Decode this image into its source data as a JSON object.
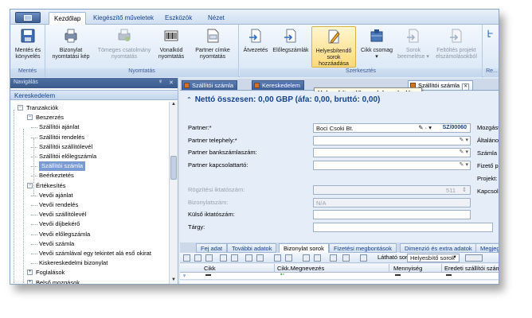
{
  "ribbon_tabs": [
    "Kezdőlap",
    "Kiegészítő műveletek",
    "Eszközök",
    "Nézet"
  ],
  "ribbon": {
    "groups": [
      {
        "label": "Mentés",
        "buttons": [
          {
            "label": [
              "Mentés és",
              "könyvelés"
            ],
            "icon": "save-icon",
            "disabled": false
          }
        ]
      },
      {
        "label": "Nyomtatás",
        "buttons": [
          {
            "label": [
              "Bizonylat",
              "nyomtatási kép"
            ],
            "icon": "print-preview-icon",
            "disabled": false
          },
          {
            "label": [
              "Tömeges csatolmány",
              "nyomtatás"
            ],
            "icon": "bulk-print-icon",
            "disabled": true
          },
          {
            "label": [
              "Vonalkód",
              "nyomtatás"
            ],
            "icon": "barcode-icon",
            "disabled": false
          },
          {
            "label": [
              "Partner címke",
              "nyomtatás"
            ],
            "icon": "label-print-icon",
            "disabled": false
          }
        ]
      },
      {
        "label": "Szerkesztés",
        "buttons": [
          {
            "label": [
              "Átvezetés"
            ],
            "icon": "transfer-icon",
            "disabled": false
          },
          {
            "label": [
              "Előlegszámlák"
            ],
            "icon": "advance-invoice-icon",
            "disabled": false
          },
          {
            "label": [
              "Helyesbítendő",
              "sorok hozzáadása"
            ],
            "icon": "correction-rows-icon",
            "disabled": false,
            "highlight": true
          },
          {
            "label": [
              "Cikk csomag",
              "▾"
            ],
            "icon": "package-icon",
            "disabled": false
          },
          {
            "label": [
              "Sorok",
              "beemelése ▾"
            ],
            "icon": "import-rows-icon",
            "disabled": true
          },
          {
            "label": [
              "Feltöltés projekt",
              "elszámolásokból"
            ],
            "icon": "upload-project-icon",
            "disabled": true
          }
        ]
      },
      {
        "label": "Re...",
        "buttons": [
          {
            "label": [
              ""
            ],
            "icon": "related-icon",
            "disabled": false
          }
        ]
      }
    ]
  },
  "nav": {
    "header": "Navigálás",
    "pin": "ᵠ",
    "close": "✕",
    "section": "Kereskedelem",
    "tree": [
      {
        "label": "Tranzakciók",
        "level": 0,
        "toggle": "−"
      },
      {
        "label": "Beszerzés",
        "level": 1,
        "toggle": "−"
      },
      {
        "label": "Szállítói ajánlat",
        "level": 2
      },
      {
        "label": "Szállítói rendelés",
        "level": 2
      },
      {
        "label": "Szállítói szállítólevél",
        "level": 2
      },
      {
        "label": "Szállítói előlegszámla",
        "level": 2
      },
      {
        "label": "Szállítói számla",
        "level": 2,
        "selected": true
      },
      {
        "label": "Beérkeztetés",
        "level": 2
      },
      {
        "label": "Értékesítés",
        "level": 1,
        "toggle": "−"
      },
      {
        "label": "Vevői ajánlat",
        "level": 2
      },
      {
        "label": "Vevői rendelés",
        "level": 2
      },
      {
        "label": "Vevői szállítólevél",
        "level": 2
      },
      {
        "label": "Vevői díjbekérő",
        "level": 2
      },
      {
        "label": "Vevői előlegszámla",
        "level": 2
      },
      {
        "label": "Vevői számla",
        "level": 2
      },
      {
        "label": "Vevői számlával egy tekintet alá eső okirat",
        "level": 2
      },
      {
        "label": "Kiskereskedelmi bizonylat",
        "level": 2
      },
      {
        "label": "Foglalások",
        "level": 1,
        "toggle": "+"
      },
      {
        "label": "Belső mozgások",
        "level": 1,
        "toggle": "+"
      }
    ]
  },
  "doc_tabs": [
    {
      "label": "Szállítói számla",
      "active": false
    },
    {
      "label": "Kereskedelem",
      "active": false
    },
    {
      "label": "Szállítói számla",
      "active": true
    }
  ],
  "tooltip": "Helyesbítendő sorok hozzáadása",
  "form": {
    "net_total": "Nettó összesen: 0,00 GBP (áfa: 0,00, bruttó: 0,00)",
    "fields": [
      {
        "label": "Partner:*",
        "value": "Boci Csoki Bt.",
        "code": "SZ/00060",
        "disabled": false
      },
      {
        "label": "Partner telephely:*",
        "value": "",
        "disabled": false
      },
      {
        "label": "Partner bankszámlaszám:",
        "value": "",
        "disabled": false
      },
      {
        "label": "Partner kapcsolattartó:",
        "value": "",
        "disabled": false
      },
      {
        "label": "Rögzítési iktatószám:",
        "value": "511",
        "disabled": true
      },
      {
        "label": "Bizonylatszám:",
        "value": "N/A",
        "disabled": true
      },
      {
        "label": "Külső iktatószám:",
        "value": "",
        "disabled": false
      },
      {
        "label": "Tárgy:",
        "value": "",
        "disabled": false
      }
    ],
    "right_labels": [
      "Mozgástípus",
      "Általános üg",
      "Számla státu",
      "Fizető partne",
      "Projekt:",
      "Kapcsolódó s"
    ]
  },
  "sub_tabs": [
    "Fej adat",
    "További adatok",
    "Bizonylat sorok",
    "Fizetési megbontások",
    "Dimenzió és extra adatok",
    "Megjegyzé"
  ],
  "active_sub_tab": "Bizonylat sorok",
  "grid": {
    "visible_rows_label": "Látható sorok",
    "visible_rows_value": "Helyesbítő sorok",
    "columns": [
      "Cikk",
      "Cikk.Megnevezés",
      "Mennyiség",
      "Eredeti szállítói számla"
    ],
    "filter_icon": "ᵩ"
  },
  "colors": {
    "accent": "#15428b",
    "highlight": "#ffd97a",
    "selection": "#7a9cd3"
  }
}
